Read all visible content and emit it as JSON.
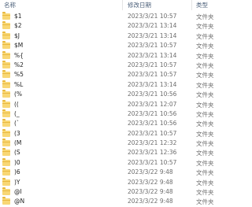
{
  "header": {
    "name": "名称",
    "date": "修改日期",
    "type": "类型"
  },
  "files": [
    {
      "name": "$1",
      "date": "2023/3/21 10:57",
      "type": "文件夹"
    },
    {
      "name": "$2",
      "date": "2023/3/21 13:14",
      "type": "文件夹"
    },
    {
      "name": "$J",
      "date": "2023/3/21 13:14",
      "type": "文件夹"
    },
    {
      "name": "$M",
      "date": "2023/3/21 10:57",
      "type": "文件夹"
    },
    {
      "name": "%{",
      "date": "2023/3/21 13:14",
      "type": "文件夹"
    },
    {
      "name": "%2",
      "date": "2023/3/21 10:57",
      "type": "文件夹"
    },
    {
      "name": "%5",
      "date": "2023/3/21 10:57",
      "type": "文件夹"
    },
    {
      "name": "%L",
      "date": "2023/3/21 13:14",
      "type": "文件夹"
    },
    {
      "name": "(%",
      "date": "2023/3/21 10:56",
      "type": "文件夹"
    },
    {
      "name": "((",
      "date": "2023/3/21 12:07",
      "type": "文件夹"
    },
    {
      "name": "(_",
      "date": "2023/3/21 10:56",
      "type": "文件夹"
    },
    {
      "name": "(`",
      "date": "2023/3/21 10:56",
      "type": "文件夹"
    },
    {
      "name": "(3",
      "date": "2023/3/21 10:57",
      "type": "文件夹"
    },
    {
      "name": "(M",
      "date": "2023/3/21 12:32",
      "type": "文件夹"
    },
    {
      "name": "(S",
      "date": "2023/3/21 12:36",
      "type": "文件夹"
    },
    {
      "name": ")0",
      "date": "2023/3/21 10:57",
      "type": "文件夹"
    },
    {
      "name": ")6",
      "date": "2023/3/22 9:48",
      "type": "文件夹"
    },
    {
      "name": ")Y",
      "date": "2023/3/22 9:48",
      "type": "文件夹"
    },
    {
      "name": "@I",
      "date": "2023/3/22 9:48",
      "type": "文件夹"
    },
    {
      "name": "@N",
      "date": "2023/3/22 9:48",
      "type": "文件夹"
    }
  ]
}
